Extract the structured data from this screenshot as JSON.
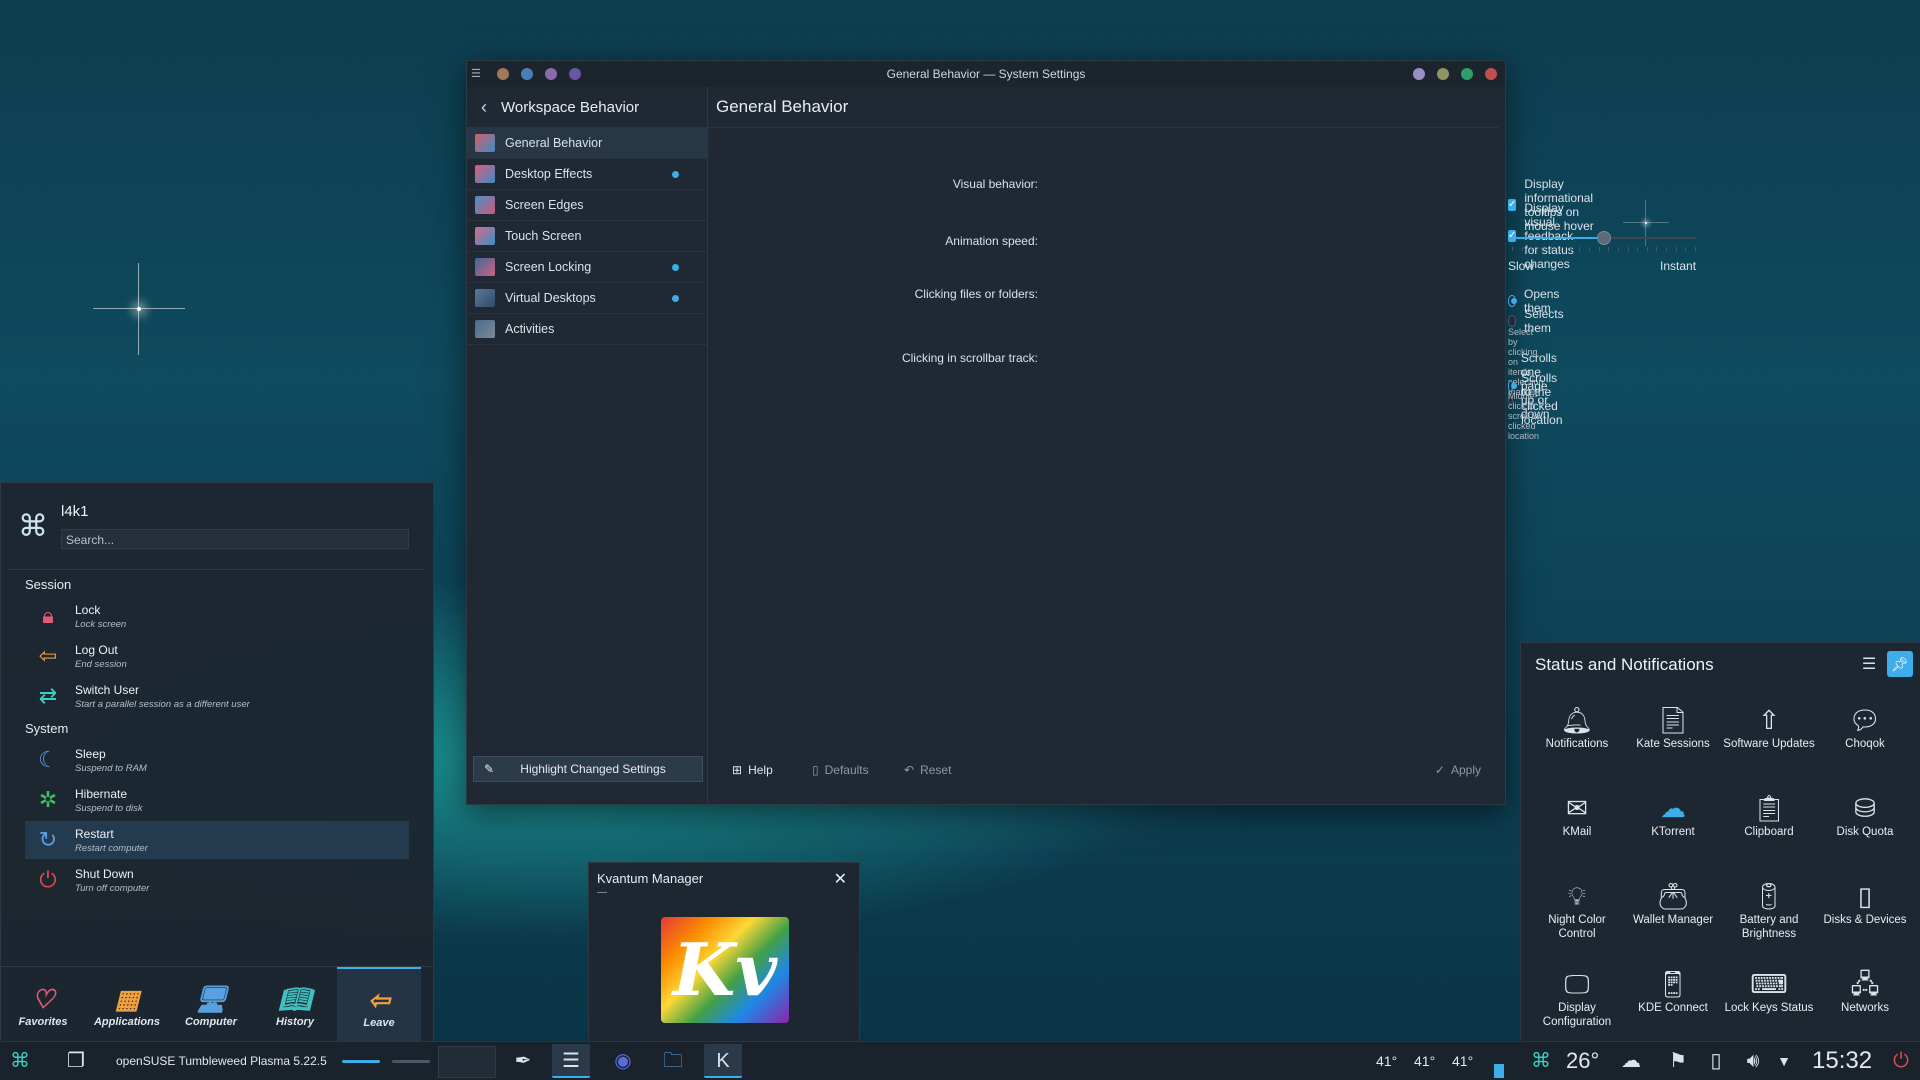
{
  "colors": {
    "accent": "#3daee9",
    "panel": "#1f2833",
    "dot1": "#a0785a",
    "dot2": "#4a7fb5",
    "dot3": "#8a6aa8",
    "dot4": "#6a55a0"
  },
  "settings": {
    "window_title": "General Behavior — System Settings",
    "sidebar_title": "Workspace Behavior",
    "sidebar_items": [
      {
        "label": "General Behavior",
        "changed": false
      },
      {
        "label": "Desktop Effects",
        "changed": true
      },
      {
        "label": "Screen Edges",
        "changed": false
      },
      {
        "label": "Touch Screen",
        "changed": false
      },
      {
        "label": "Screen Locking",
        "changed": true
      },
      {
        "label": "Virtual Desktops",
        "changed": true
      },
      {
        "label": "Activities",
        "changed": false
      }
    ],
    "highlight_button": "Highlight Changed Settings",
    "page_title": "General Behavior",
    "visual_behavior_label": "Visual behavior:",
    "tooltips_option": "Display informational tooltips on mouse hover",
    "feedback_option": "Display visual feedback for status changes",
    "animation_label": "Animation speed:",
    "animation_value_fraction": 0.5,
    "slow": "Slow",
    "instant": "Instant",
    "clicking_label": "Clicking files or folders:",
    "opens_them": "Opens them",
    "selects_them": "Selects them",
    "select_hint": "Select by clicking on item's selection marker",
    "scroll_label": "Clicking in scrollbar track:",
    "scroll_page": "Scrolls one page up or down",
    "scroll_location": "Scrolls to the clicked location",
    "scroll_hint": "Middle-click to scroll to clicked location",
    "help": "Help",
    "defaults": "Defaults",
    "reset": "Reset",
    "apply": "Apply"
  },
  "launcher": {
    "user": "l4k1",
    "search_placeholder": "Search...",
    "session_header": "Session",
    "system_header": "System",
    "session_items": [
      {
        "name": "Lock",
        "desc": "Lock screen",
        "icon": "lock-icon"
      },
      {
        "name": "Log Out",
        "desc": "End session",
        "icon": "logout-icon"
      },
      {
        "name": "Switch User",
        "desc": "Start a parallel session as a different user",
        "icon": "switch-user-icon"
      }
    ],
    "system_items": [
      {
        "name": "Sleep",
        "desc": "Suspend to RAM",
        "icon": "sleep-icon"
      },
      {
        "name": "Hibernate",
        "desc": "Suspend to disk",
        "icon": "hibernate-icon"
      },
      {
        "name": "Restart",
        "desc": "Restart computer",
        "icon": "restart-icon"
      },
      {
        "name": "Shut Down",
        "desc": "Turn off computer",
        "icon": "shutdown-icon"
      }
    ],
    "tabs": [
      "Favorites",
      "Applications",
      "Computer",
      "History",
      "Leave"
    ]
  },
  "kvantum": {
    "title": "Kvantum Manager",
    "subtitle": "—",
    "logo_text": "Kv"
  },
  "status": {
    "title": "Status and Notifications",
    "items": [
      "Notifications",
      "Kate Sessions",
      "Software Updates",
      "Choqok",
      "KMail",
      "KTorrent",
      "Clipboard",
      "Disk Quota",
      "Night Color Control",
      "Wallet Manager",
      "Battery and Brightness",
      "Disks & Devices",
      "Display Configuration",
      "KDE Connect",
      "Lock Keys Status",
      "Networks"
    ]
  },
  "taskbar": {
    "desktop_label": "openSUSE Tumbleweed Plasma 5.22.5",
    "temps": [
      "41°",
      "41°",
      "41°"
    ],
    "weather": "26°",
    "clock": "15:32"
  }
}
